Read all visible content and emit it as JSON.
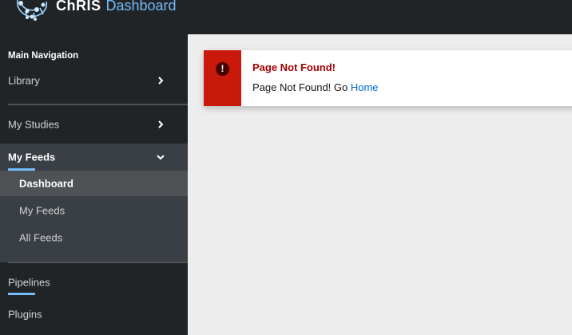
{
  "header": {
    "brand_name": "ChRIS",
    "brand_subtitle": "Dashboard",
    "logo_icon": "brain-logo-icon"
  },
  "sidebar": {
    "section_title": "Main Navigation",
    "items": [
      {
        "label": "Library",
        "icon": "chevron-right-icon"
      },
      {
        "label": "My Studies",
        "icon": "chevron-right-icon"
      },
      {
        "label": "My Feeds",
        "icon": "chevron-down-icon",
        "expanded": true
      },
      {
        "label": "Pipelines"
      },
      {
        "label": "Plugins"
      }
    ],
    "feeds_submenu": [
      {
        "label": "Dashboard",
        "current": true
      },
      {
        "label": "My Feeds"
      },
      {
        "label": "All Feeds"
      }
    ],
    "accent_color": "#73bcf7"
  },
  "alert": {
    "title": "Page Not Found!",
    "message_prefix": "Page Not Found! Go ",
    "link_text": "Home",
    "icon": "exclamation-circle-icon",
    "status_color": "#c9190b"
  }
}
